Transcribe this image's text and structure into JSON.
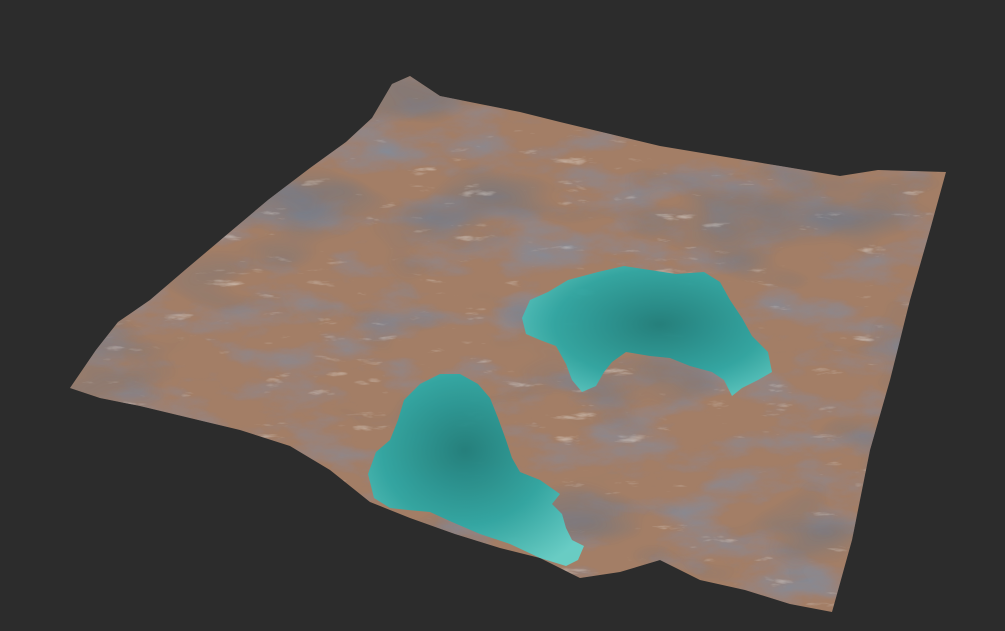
{
  "scene": {
    "subject": "terrain-mesh",
    "background_color": "#2c2c2c",
    "terrain": {
      "rock_color": "#a37e66",
      "shadow_color": "#3d4452",
      "highlight_color": "#d9d2c8"
    },
    "water": {
      "color": "#2fa7a3",
      "deep_color": "#1f7f7c",
      "shallow_color": "#66d0c8",
      "pools": 2
    }
  }
}
